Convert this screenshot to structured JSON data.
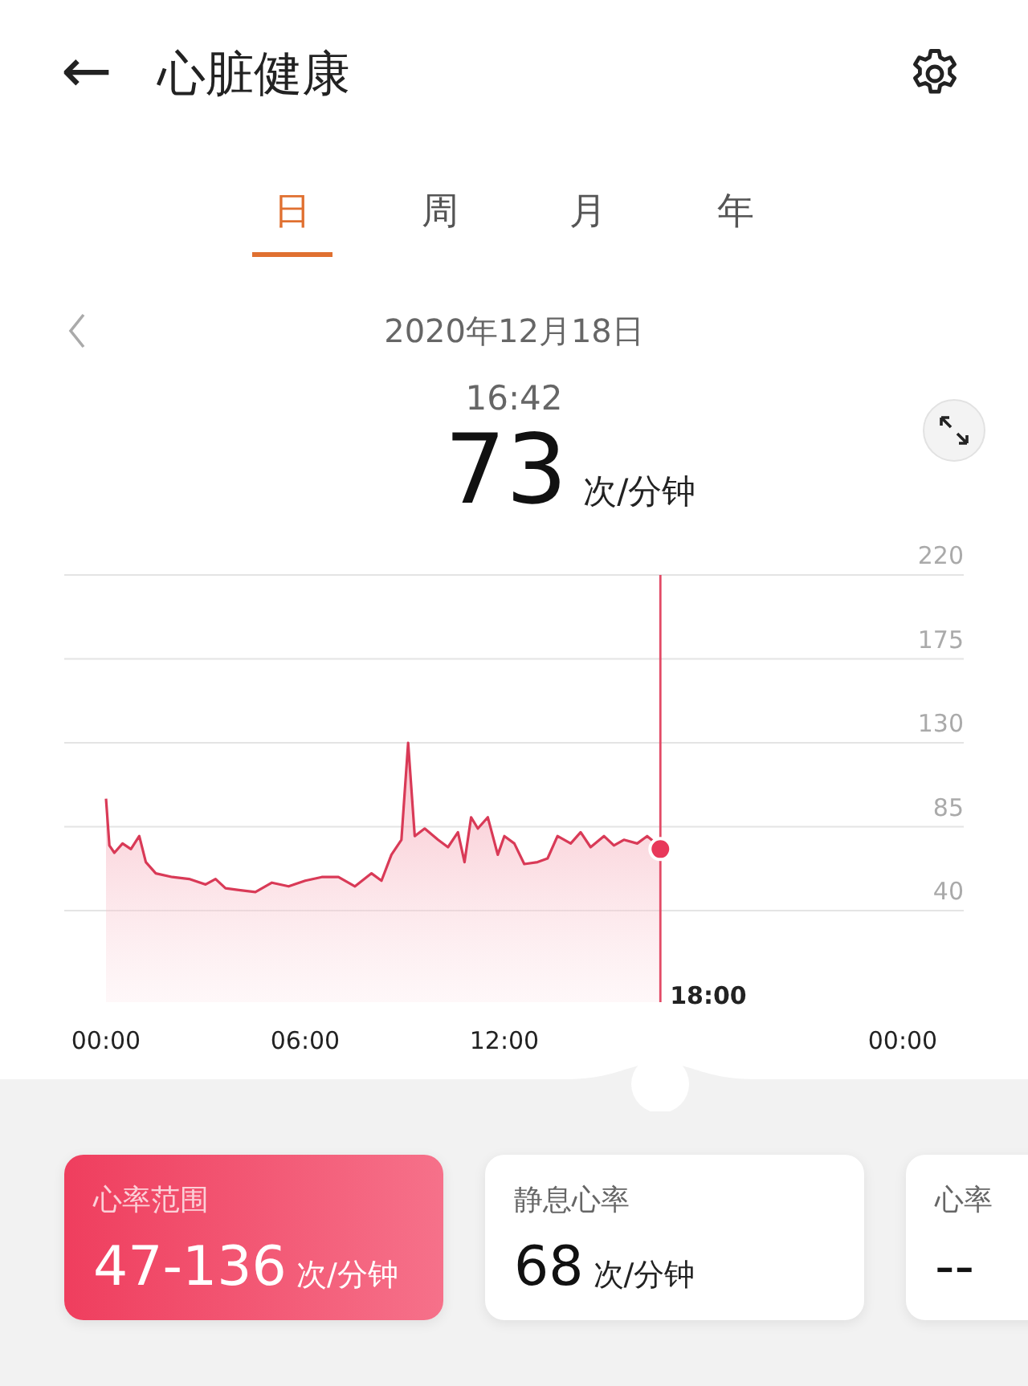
{
  "header": {
    "back": "←",
    "title": "心脏健康"
  },
  "tabs": [
    {
      "label": "日",
      "selected": true
    },
    {
      "label": "周",
      "selected": false
    },
    {
      "label": "月",
      "selected": false
    },
    {
      "label": "年",
      "selected": false
    }
  ],
  "date": "2020年12月18日",
  "reading": {
    "time": "16:42",
    "value": "73",
    "unit": "次/分钟"
  },
  "chart": {
    "cursor_label": "18:00",
    "chart_data": {
      "type": "area",
      "x": [
        0,
        0.1,
        0.25,
        0.5,
        0.75,
        1,
        1.2,
        1.5,
        2,
        2.5,
        3,
        3.3,
        3.6,
        4,
        4.5,
        5,
        5.5,
        6,
        6.5,
        7,
        7.5,
        8,
        8.3,
        8.6,
        8.9,
        9.1,
        9.3,
        9.6,
        10,
        10.3,
        10.6,
        10.8,
        11,
        11.2,
        11.5,
        11.8,
        12,
        12.3,
        12.6,
        13,
        13.3,
        13.6,
        14,
        14.3,
        14.6,
        15,
        15.3,
        15.6,
        16,
        16.3,
        16.5,
        16.7
      ],
      "series": [
        {
          "color": "#d93a57",
          "values": [
            100,
            75,
            71,
            76,
            73,
            80,
            66,
            60,
            58,
            57,
            54,
            57,
            52,
            51,
            50,
            55,
            53,
            56,
            58,
            58,
            53,
            60,
            56,
            70,
            78,
            130,
            80,
            84,
            78,
            74,
            82,
            66,
            90,
            84,
            90,
            70,
            80,
            76,
            65,
            66,
            68,
            80,
            76,
            82,
            74,
            80,
            75,
            78,
            76,
            80,
            77,
            73
          ]
        }
      ],
      "xlim": [
        0,
        24
      ],
      "ylim": [
        40,
        220
      ],
      "ref_lines": [
        {
          "axis": "x",
          "value": 16.7
        }
      ],
      "xticks": [
        {
          "value": 0,
          "label": "00:00"
        },
        {
          "value": 6,
          "label": "06:00"
        },
        {
          "value": 12,
          "label": "12:00"
        },
        {
          "value": 24,
          "label": "00:00"
        }
      ],
      "yticks": [
        220,
        175,
        130,
        85,
        40
      ],
      "grid": true
    }
  },
  "cards": [
    {
      "title": "心率范围",
      "value": "47-136",
      "unit": "次/分钟",
      "selected": true
    },
    {
      "title": "静息心率",
      "value": "68",
      "unit": "次/分钟",
      "selected": false
    },
    {
      "title": "心率",
      "value": "--",
      "selected": false
    }
  ]
}
